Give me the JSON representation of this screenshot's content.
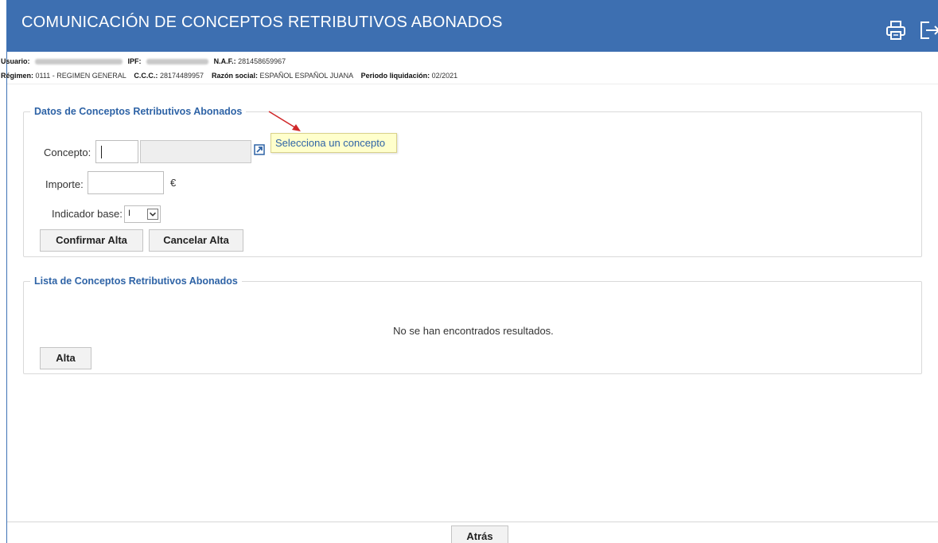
{
  "header": {
    "title": "COMUNICACIÓN DE CONCEPTOS RETRIBUTIVOS ABONADOS",
    "print_icon": "printer-icon",
    "exit_icon": "logout-icon"
  },
  "info": {
    "usuario_label": "Usuario:",
    "ipf_label": "IPF:",
    "naf_label": "N.A.F.:",
    "naf_value": "281458659967",
    "regimen_label": "Régimen:",
    "regimen_value": "0111 - REGIMEN GENERAL",
    "ccc_label": "C.C.C.:",
    "ccc_value": "28174489957",
    "razon_label": "Razón social:",
    "razon_value": "ESPAÑOL ESPAÑOL JUANA",
    "periodo_label": "Periodo liquidación:",
    "periodo_value": "02/2021"
  },
  "datos": {
    "legend": "Datos de Conceptos Retributivos Abonados",
    "concepto_label": "Concepto:",
    "importe_label": "Importe:",
    "currency": "€",
    "indicador_label": "Indicador base:",
    "indicador_value": "I",
    "tooltip": "Selecciona un concepto",
    "confirm_label": "Confirmar Alta",
    "cancel_label": "Cancelar Alta",
    "arrow_color": "#d0282a"
  },
  "lista": {
    "legend": "Lista de Conceptos Retributivos Abonados",
    "empty": "No se han encontrados resultados.",
    "alta_label": "Alta"
  },
  "footer": {
    "back_label": "Atrás"
  },
  "colors": {
    "header_bg": "#3d6fb1",
    "legend": "#2e63a6"
  }
}
